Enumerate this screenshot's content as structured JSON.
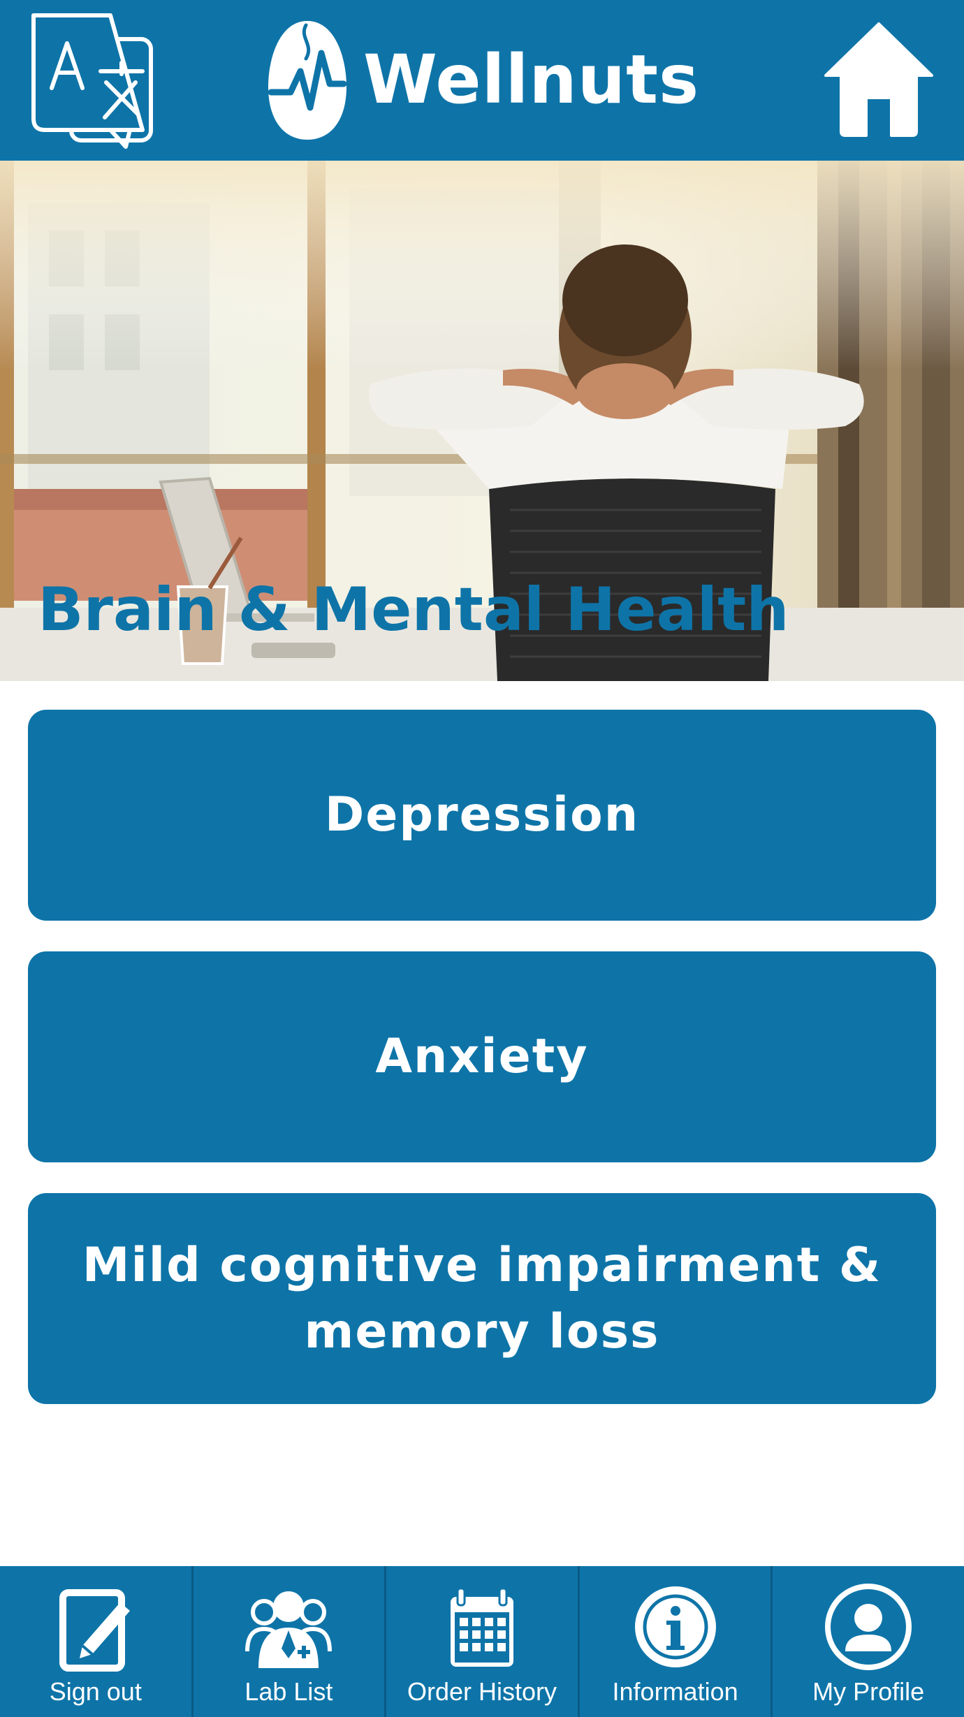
{
  "header": {
    "app_name": "Wellnuts",
    "icons": {
      "language": "translate-icon",
      "logo": "wellnuts-logo",
      "home": "home-icon"
    }
  },
  "hero": {
    "title": "Brain & Mental Health",
    "image": "man-relaxing-at-desk-photo"
  },
  "topics": [
    {
      "label": "Depression"
    },
    {
      "label": "Anxiety"
    },
    {
      "label": "Mild cognitive impairment & memory loss"
    }
  ],
  "bottom_nav": [
    {
      "label": "Sign out",
      "icon": "edit-note-icon"
    },
    {
      "label": "Lab List",
      "icon": "doctors-group-icon"
    },
    {
      "label": "Order History",
      "icon": "calendar-icon"
    },
    {
      "label": "Information",
      "icon": "info-icon"
    },
    {
      "label": "My Profile",
      "icon": "user-profile-icon"
    }
  ],
  "colors": {
    "brand_blue": "#0e74a8",
    "text_on_brand": "#ffffff",
    "background": "#ffffff"
  }
}
